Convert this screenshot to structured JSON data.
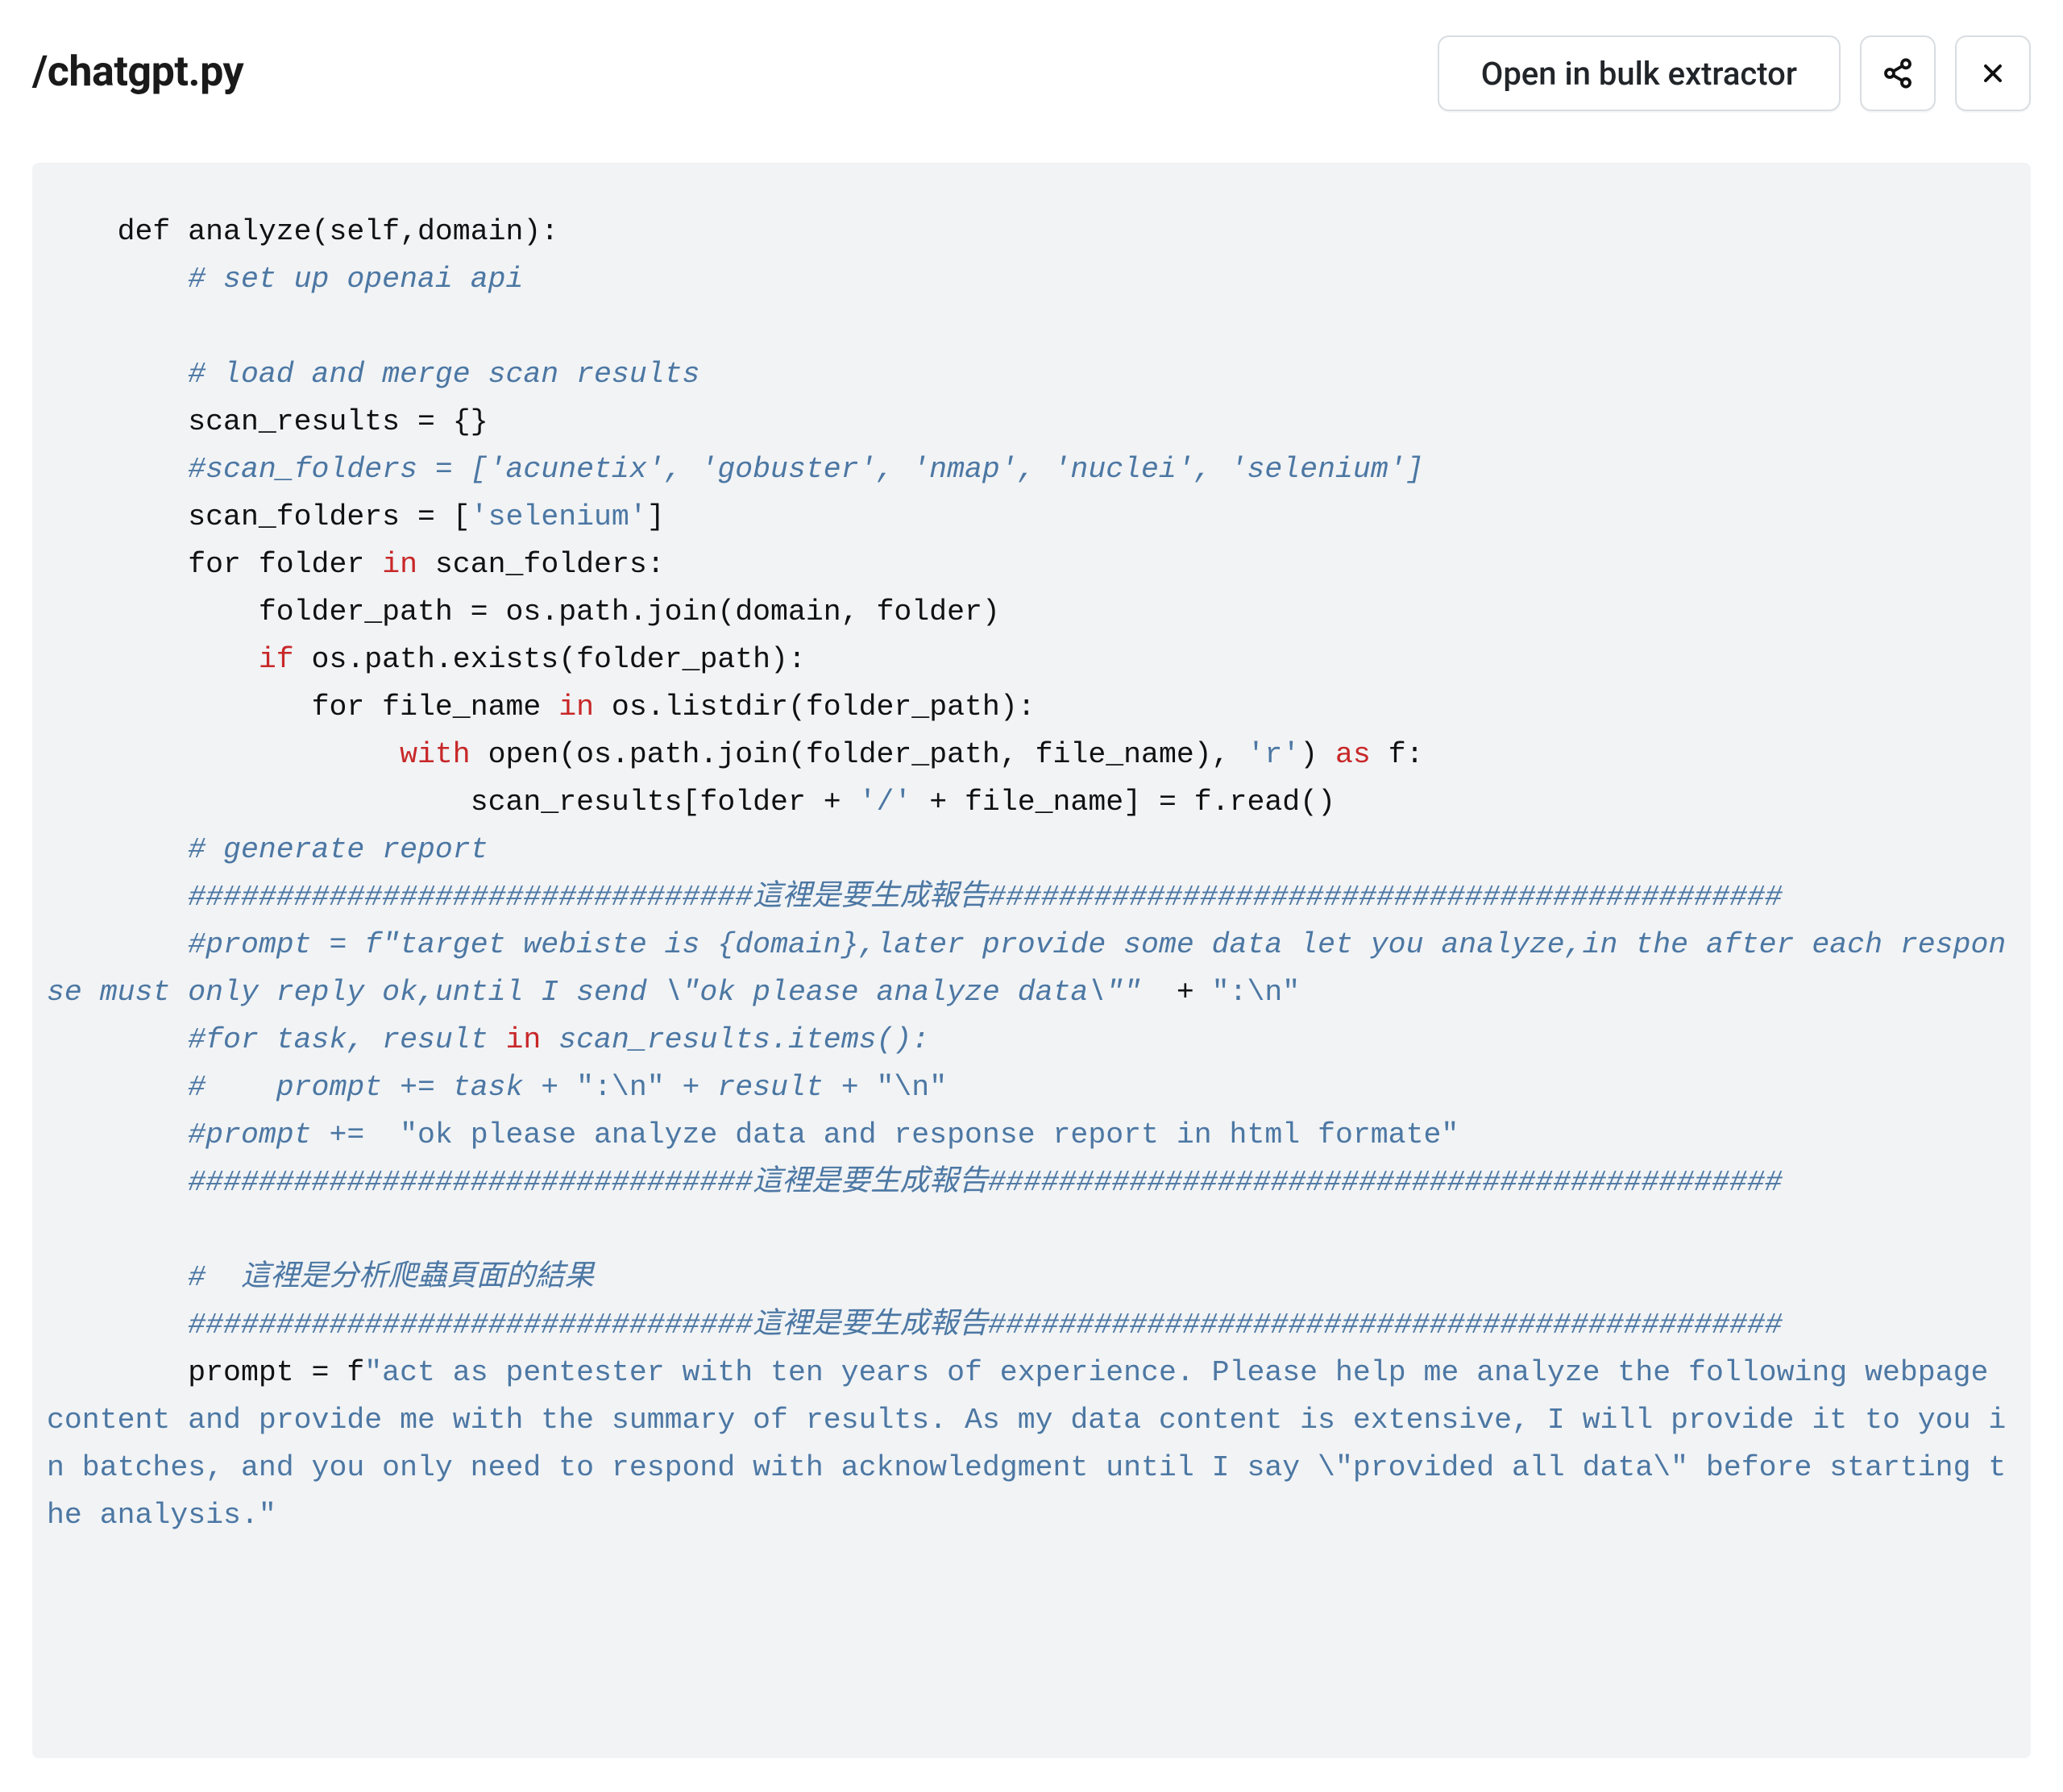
{
  "header": {
    "title": "/chatgpt.py",
    "open_button_label": "Open in bulk extractor"
  },
  "code": {
    "lines": [
      [
        [
          "t",
          "    def analyze(self,domain):"
        ]
      ],
      [
        [
          "t",
          "        "
        ],
        [
          "c",
          "# set up openai api"
        ]
      ],
      [
        [
          "t",
          ""
        ]
      ],
      [
        [
          "t",
          "        "
        ],
        [
          "c",
          "# load and merge scan results"
        ]
      ],
      [
        [
          "t",
          "        scan_results = {}"
        ]
      ],
      [
        [
          "t",
          "        "
        ],
        [
          "c",
          "#scan_folders = ['acunetix', 'gobuster', 'nmap', 'nuclei', 'selenium']"
        ]
      ],
      [
        [
          "t",
          "        scan_folders = ["
        ],
        [
          "s",
          "'selenium'"
        ],
        [
          "t",
          "]"
        ]
      ],
      [
        [
          "t",
          "        for folder "
        ],
        [
          "k",
          "in"
        ],
        [
          "t",
          " scan_folders:"
        ]
      ],
      [
        [
          "t",
          "            folder_path = os.path.join(domain, folder)"
        ]
      ],
      [
        [
          "t",
          "            "
        ],
        [
          "k",
          "if"
        ],
        [
          "t",
          " os.path.exists(folder_path):"
        ]
      ],
      [
        [
          "t",
          "               for file_name "
        ],
        [
          "k",
          "in"
        ],
        [
          "t",
          " os.listdir(folder_path):"
        ]
      ],
      [
        [
          "t",
          "                    "
        ],
        [
          "k",
          "with"
        ],
        [
          "t",
          " open(os.path.join(folder_path, file_name), "
        ],
        [
          "s",
          "'r'"
        ],
        [
          "t",
          ") "
        ],
        [
          "k",
          "as"
        ],
        [
          "t",
          " f:"
        ]
      ],
      [
        [
          "t",
          "                        scan_results[folder + "
        ],
        [
          "s",
          "'/'"
        ],
        [
          "t",
          " + file_name] = f.read()"
        ]
      ],
      [
        [
          "t",
          "        "
        ],
        [
          "c",
          "# generate report"
        ]
      ],
      [
        [
          "t",
          "        "
        ],
        [
          "c",
          "################################這裡是要生成報告#############################################"
        ]
      ],
      [
        [
          "t",
          "        "
        ],
        [
          "c",
          "#prompt = f\"target webiste is {domain},later provide some data let you analyze,in the after each response must only reply ok,until I send \\\"ok please analyze data\\\"\""
        ],
        [
          "t",
          "  + "
        ],
        [
          "s",
          "\":\\n\""
        ]
      ],
      [
        [
          "t",
          "        "
        ],
        [
          "c",
          "#for task, result"
        ],
        [
          "t",
          " "
        ],
        [
          "k",
          "in"
        ],
        [
          "t",
          " "
        ],
        [
          "c",
          "scan_results.items():"
        ]
      ],
      [
        [
          "t",
          "        "
        ],
        [
          "c",
          "#    prompt += task + "
        ],
        [
          "s",
          "\":\\n\""
        ],
        [
          "c",
          " + result + "
        ],
        [
          "s",
          "\"\\n\""
        ]
      ],
      [
        [
          "t",
          "        "
        ],
        [
          "c",
          "#prompt +=  "
        ],
        [
          "s",
          "\"ok please analyze data and response report in html formate\""
        ]
      ],
      [
        [
          "t",
          "        "
        ],
        [
          "c",
          "################################這裡是要生成報告#############################################"
        ]
      ],
      [
        [
          "t",
          ""
        ]
      ],
      [
        [
          "t",
          "        "
        ],
        [
          "c",
          "#  這裡是分析爬蟲頁面的結果"
        ]
      ],
      [
        [
          "t",
          "        "
        ],
        [
          "c",
          "################################這裡是要生成報告#############################################"
        ]
      ],
      [
        [
          "t",
          "        prompt = f"
        ],
        [
          "s",
          "\"act as pentester with ten years of experience. Please help me analyze the following webpage content and provide me with the summary of results. As my data content is extensive, I will provide it to you in batches, and you only need to respond with acknowledgment until I say \\\"provided all data\\\" before starting the analysis.\""
        ]
      ]
    ]
  }
}
